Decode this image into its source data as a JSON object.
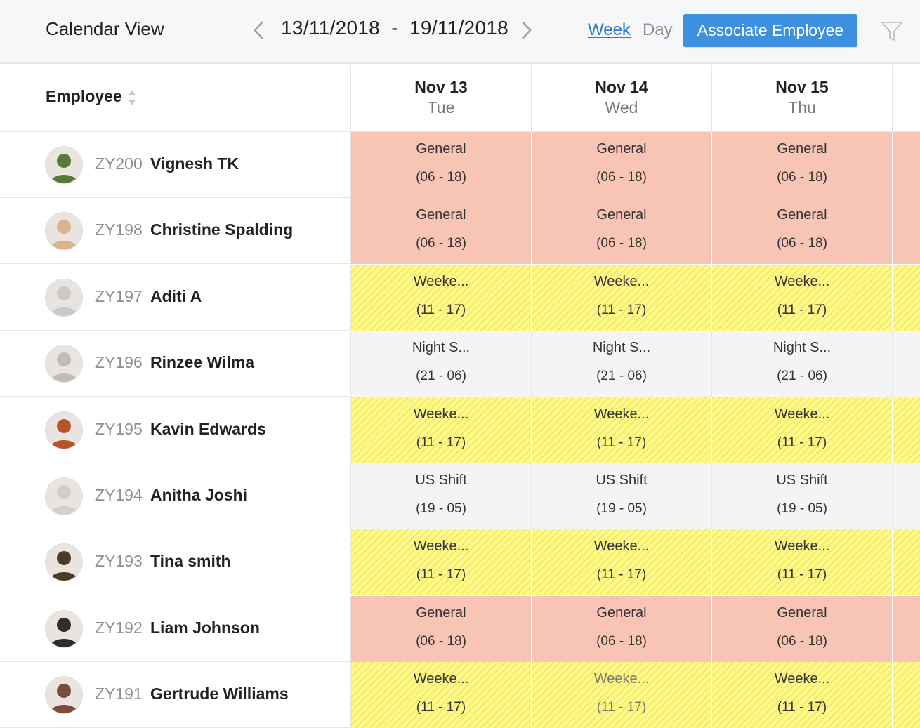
{
  "header": {
    "title": "Calendar View",
    "date_range": "13/11/2018  -  19/11/2018",
    "view_week": "Week",
    "view_day": "Day",
    "associate_button": "Associate Employee"
  },
  "colors": {
    "accent": "#3d8fe0",
    "link": "#2b79c9",
    "general": "#f8c4b5",
    "weekend": "#fdf98a",
    "night": "#f4f4f4"
  },
  "table": {
    "employee_header": "Employee",
    "days": [
      {
        "date": "Nov 13",
        "day": "Tue"
      },
      {
        "date": "Nov 14",
        "day": "Wed"
      },
      {
        "date": "Nov 15",
        "day": "Thu"
      }
    ],
    "rows": [
      {
        "id": "ZY200",
        "name": "Vignesh TK",
        "avatar": "#5a7a3a",
        "shifts": [
          {
            "type": "general",
            "name": "General",
            "time": "(06 - 18)"
          },
          {
            "type": "general",
            "name": "General",
            "time": "(06 - 18)"
          },
          {
            "type": "general",
            "name": "General",
            "time": "(06 - 18)"
          }
        ]
      },
      {
        "id": "ZY198",
        "name": "Christine Spalding",
        "avatar": "#d9b48a",
        "shifts": [
          {
            "type": "general",
            "name": "General",
            "time": "(06 - 18)"
          },
          {
            "type": "general",
            "name": "General",
            "time": "(06 - 18)"
          },
          {
            "type": "general",
            "name": "General",
            "time": "(06 - 18)"
          }
        ]
      },
      {
        "id": "ZY197",
        "name": "Aditi A",
        "avatar": "#c9c9c9",
        "shifts": [
          {
            "type": "weekend",
            "name": "Weeke...",
            "time": "(11 - 17)"
          },
          {
            "type": "weekend",
            "name": "Weeke...",
            "time": "(11 - 17)"
          },
          {
            "type": "weekend",
            "name": "Weeke...",
            "time": "(11 - 17)"
          }
        ]
      },
      {
        "id": "ZY196",
        "name": "Rinzee Wilma",
        "avatar": "#bdbdbd",
        "shifts": [
          {
            "type": "night",
            "name": "Night S...",
            "time": "(21 - 06)"
          },
          {
            "type": "night",
            "name": "Night S...",
            "time": "(21 - 06)"
          },
          {
            "type": "night",
            "name": "Night S...",
            "time": "(21 - 06)"
          }
        ]
      },
      {
        "id": "ZY195",
        "name": "Kavin Edwards",
        "avatar": "#b5542a",
        "shifts": [
          {
            "type": "weekend",
            "name": "Weeke...",
            "time": "(11 - 17)"
          },
          {
            "type": "weekend",
            "name": "Weeke...",
            "time": "(11 - 17)"
          },
          {
            "type": "weekend",
            "name": "Weeke...",
            "time": "(11 - 17)"
          }
        ]
      },
      {
        "id": "ZY194",
        "name": "Anitha Joshi",
        "avatar": "#cfcfcf",
        "shifts": [
          {
            "type": "night",
            "name": "US Shift",
            "time": "(19 - 05)"
          },
          {
            "type": "night",
            "name": "US Shift",
            "time": "(19 - 05)"
          },
          {
            "type": "night",
            "name": "US Shift",
            "time": "(19 - 05)"
          }
        ]
      },
      {
        "id": "ZY193",
        "name": "Tina smith",
        "avatar": "#4a3a2a",
        "shifts": [
          {
            "type": "weekend",
            "name": "Weeke...",
            "time": "(11 - 17)"
          },
          {
            "type": "weekend",
            "name": "Weeke...",
            "time": "(11 - 17)"
          },
          {
            "type": "weekend",
            "name": "Weeke...",
            "time": "(11 - 17)"
          }
        ]
      },
      {
        "id": "ZY192",
        "name": "Liam Johnson",
        "avatar": "#2e2e2e",
        "shifts": [
          {
            "type": "general",
            "name": "General",
            "time": "(06 - 18)"
          },
          {
            "type": "general",
            "name": "General",
            "time": "(06 - 18)"
          },
          {
            "type": "general",
            "name": "General",
            "time": "(06 - 18)"
          }
        ]
      },
      {
        "id": "ZY191",
        "name": "Gertrude Williams",
        "avatar": "#7a4a3a",
        "shifts": [
          {
            "type": "weekend",
            "name": "Weeke...",
            "time": "(11 - 17)"
          },
          {
            "type": "weekend faded",
            "name": "Weeke...",
            "time": "(11 - 17)"
          },
          {
            "type": "weekend",
            "name": "Weeke...",
            "time": "(11 - 17)"
          }
        ]
      }
    ]
  }
}
